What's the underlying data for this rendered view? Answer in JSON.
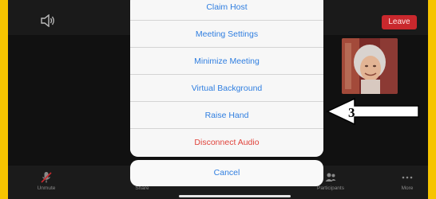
{
  "top_bar": {
    "leave_label": "Leave"
  },
  "menu": {
    "items": [
      {
        "label": "Claim Host"
      },
      {
        "label": "Meeting Settings"
      },
      {
        "label": "Minimize Meeting"
      },
      {
        "label": "Virtual Background"
      },
      {
        "label": "Raise Hand"
      },
      {
        "label": "Disconnect Audio"
      }
    ],
    "cancel_label": "Cancel"
  },
  "toolbar": {
    "items": [
      {
        "label": "Unmute",
        "icon": "muted-mic-icon"
      },
      {
        "label": "Share",
        "icon": "share-icon"
      },
      {
        "label": "Participants",
        "icon": "participants-icon"
      },
      {
        "label": "More",
        "icon": "more-icon"
      }
    ]
  },
  "annotation": {
    "number": "3"
  },
  "colors": {
    "border": "#f6c400",
    "accent_blue": "#2f7ee0",
    "danger_red": "#e0433b",
    "leave_red": "#c9282d"
  }
}
